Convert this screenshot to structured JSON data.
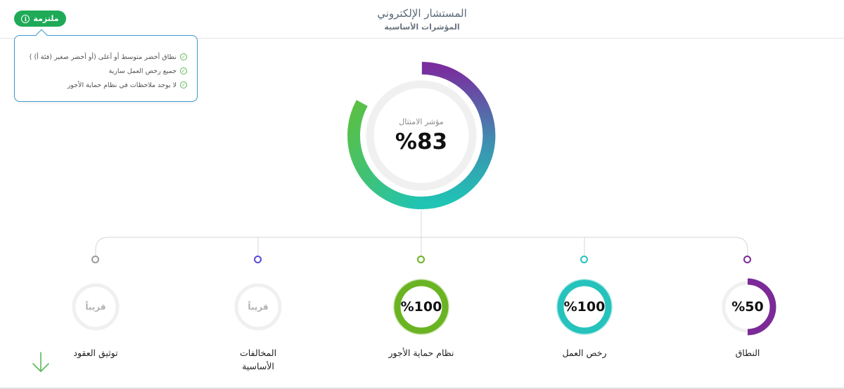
{
  "header": {
    "title": "المستشار الإلكتروني",
    "subtitle": "المؤشرات الأساسية"
  },
  "status": {
    "label": "ملتزمة",
    "icon": "info-icon",
    "color": "#1faa58"
  },
  "tooltip": {
    "items": [
      "نطاق أخضر متوسط أو أعلى (أو أخضر صغير (فئة أ) )",
      "جميع رخص العمل سارية",
      "لا يوجد ملاحظات في نظام حماية الأجور"
    ]
  },
  "compliance": {
    "label": "مؤشر الامتثال",
    "value_text": "%83",
    "value": 83
  },
  "indicators": [
    {
      "label": "النطاق",
      "value_text": "%50",
      "value": 50,
      "color": "#7b2a97",
      "soon": false
    },
    {
      "label": "رخص العمل",
      "value_text": "%100",
      "value": 100,
      "color": "#26c2bc",
      "soon": false
    },
    {
      "label": "نظام حماية الأجور",
      "value_text": "%100",
      "value": 100,
      "color": "#6ab322",
      "soon": false
    },
    {
      "label": "المخالفات الأساسية",
      "value_text": "قريباً",
      "value": null,
      "color": "#5a4ad1",
      "soon": true
    },
    {
      "label": "توثيق العقود",
      "value_text": "قريباً",
      "value": null,
      "color": "#9a9a9a",
      "soon": true
    }
  ],
  "icons": {
    "scroll": "arrow-down-icon",
    "scroll_color": "#5cb85c"
  }
}
